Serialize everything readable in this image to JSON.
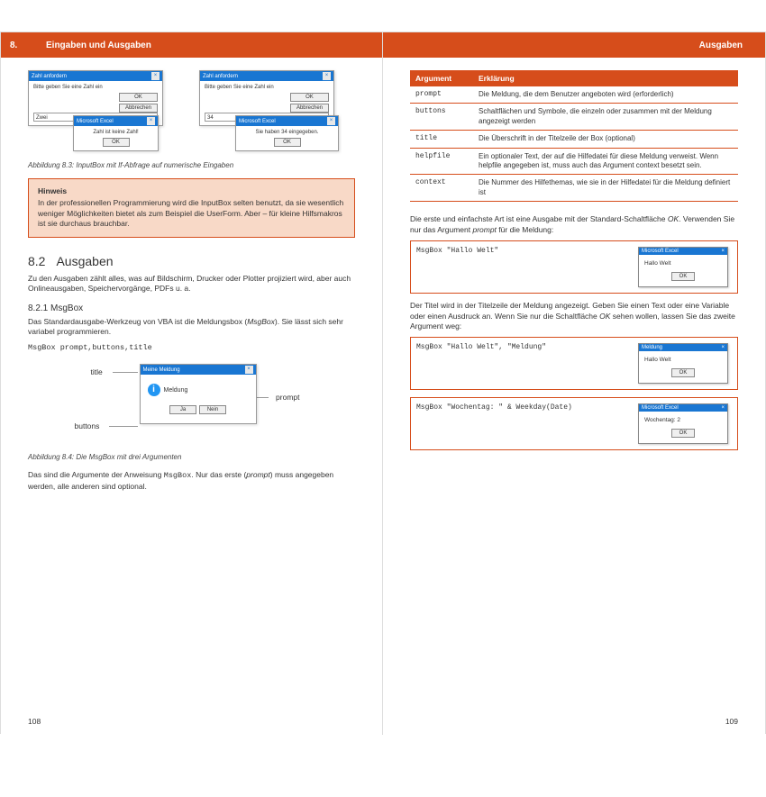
{
  "left": {
    "header_num": "8.",
    "header_title": "Eingaben und Ausgaben",
    "dlg1_title": "Zahl anfordern",
    "dlg1_msg": "Bitte geben Sie eine Zahl ein",
    "dlg1_input": "Zwei",
    "dlg1_ok": "OK",
    "dlg1_cancel": "Abbrechen",
    "dlg1b_title": "Microsoft Excel",
    "dlg1b_msg": "Zahl ist keine Zahl!",
    "dlg1b_ok": "OK",
    "dlg2_title": "Zahl anfordern",
    "dlg2_msg": "Bitte geben Sie eine Zahl ein",
    "dlg2_input": "34",
    "dlg2_ok": "OK",
    "dlg2_cancel": "Abbrechen",
    "dlg2b_title": "Microsoft Excel",
    "dlg2b_msg": "Sie haben 34 eingegeben.",
    "dlg2b_ok": "OK",
    "caption1": "Abbildung 8.3: InputBox mit If-Abfrage auf numerische Eingaben",
    "hinweis_title": "Hinweis",
    "hinweis_body": "In der professionellen Programmierung wird die InputBox selten benutzt, da sie wesentlich weniger Möglichkeiten bietet als zum Beispiel die UserForm. Aber – für kleine Hilfsmakros ist sie durchaus brauchbar.",
    "h2_num": "8.2",
    "h2_title": "Ausgaben",
    "p1": "Zu den Ausgaben zählt alles, was auf Bildschirm, Drucker oder Plotter projiziert wird, aber auch Onlineausgaben, Speichervorgänge, PDFs u. a.",
    "h3": "8.2.1  MsgBox",
    "p2a": "Das Standardausgabe-Werkzeug von VBA ist die Meldungsbox (",
    "p2b": "MsgBox",
    "p2c": "). Sie lässt sich sehr variabel programmieren.",
    "code1": "MsgBox prompt,buttons,title",
    "diag_title": "Meine Meldung",
    "diag_prompt": "Meldung",
    "diag_ja": "Ja",
    "diag_nein": "Nein",
    "lbl_title": "title",
    "lbl_prompt": "prompt",
    "lbl_buttons": "buttons",
    "caption2": "Abbildung 8.4: Die MsgBox mit drei Argumenten",
    "p3a": "Das sind die Argumente der Anweisung ",
    "p3b": "MsgBox",
    "p3c": ". Nur das erste (",
    "p3d": "prompt",
    "p3e": ") muss angegeben werden, alle anderen sind optional.",
    "pagenum": "108"
  },
  "right": {
    "header_title": "Ausgaben",
    "th1": "Argument",
    "th2": "Erklärung",
    "rows": [
      {
        "a": "prompt",
        "b": "Die Meldung, die dem Benutzer angeboten wird (erforderlich)"
      },
      {
        "a": "buttons",
        "b": "Schaltflächen und Symbole, die einzeln oder zusammen mit der Meldung angezeigt werden"
      },
      {
        "a": "title",
        "b": "Die Überschrift in der Titelzeile der Box (optional)"
      },
      {
        "a": "helpfile",
        "b": "Ein optionaler Text, der auf die Hilfedatei für diese Meldung verweist. Wenn helpfile angegeben ist, muss auch das Argument context besetzt sein."
      },
      {
        "a": "context",
        "b": "Die Nummer des Hilfethemas, wie sie in der Hilfedatei für die Meldung definiert ist"
      }
    ],
    "p1a": "Die erste und einfachste Art ist eine Ausgabe mit der Standard-Schaltfläche ",
    "p1b": "OK",
    "p1c": ". Verwenden Sie nur das Argument ",
    "p1d": "prompt",
    "p1e": " für die Meldung:",
    "code1": "MsgBox \"Hallo Welt\"",
    "win1_title": "Microsoft Excel",
    "win1_msg": "Hallo Welt",
    "win1_ok": "OK",
    "p2a": "Der Titel wird in der Titelzeile der Meldung angezeigt. Geben Sie einen Text oder eine Variable oder einen Ausdruck an. Wenn Sie nur die Schaltfläche ",
    "p2b": "OK",
    "p2c": " sehen wollen, lassen Sie das zweite Argument weg:",
    "code2": "MsgBox \"Hallo Welt\", \"Meldung\"",
    "win2_title": "Meldung",
    "win2_msg": "Hallo Welt",
    "win2_ok": "OK",
    "code3": "MsgBox \"Wochentag: \" & Weekday(Date)",
    "win3_title": "Microsoft Excel",
    "win3_msg": "Wochentag: 2",
    "win3_ok": "OK",
    "pagenum": "109"
  }
}
